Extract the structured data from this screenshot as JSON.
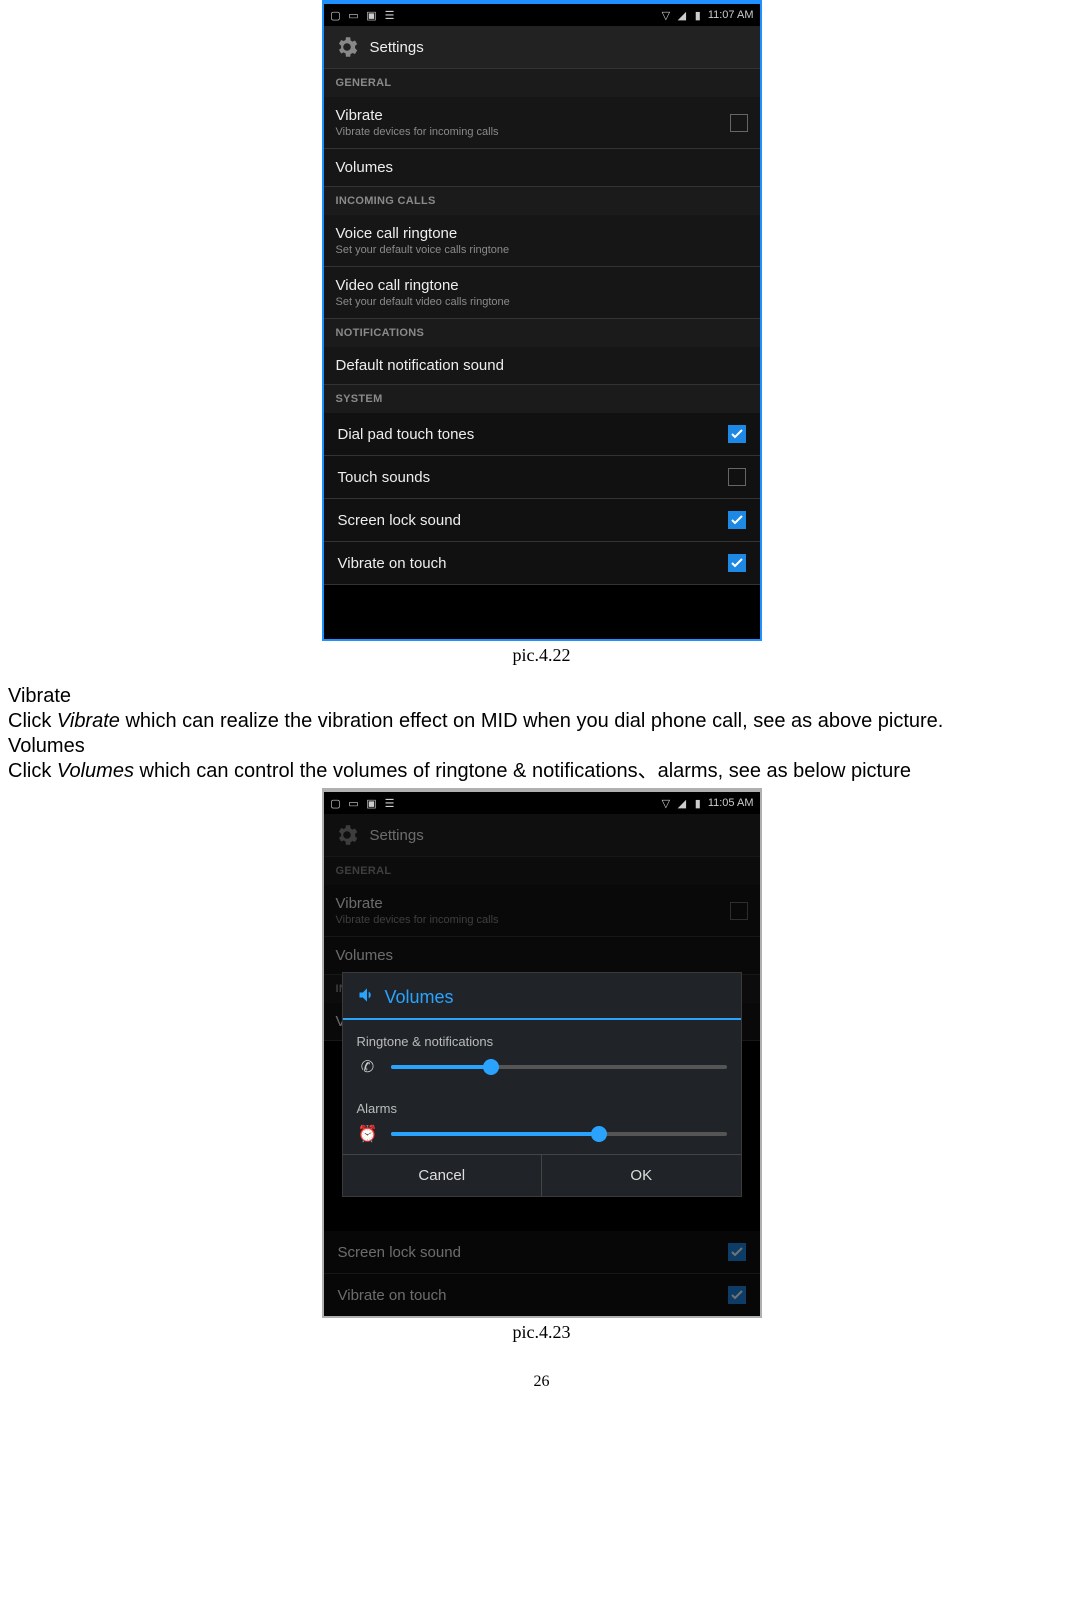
{
  "shot1": {
    "status": {
      "time": "11:07 AM"
    },
    "title": "Settings",
    "sections": {
      "general": "GENERAL",
      "incoming": "INCOMING CALLS",
      "notifications": "NOTIFICATIONS",
      "system": "SYSTEM"
    },
    "rows": {
      "vibrate": {
        "title": "Vibrate",
        "sub": "Vibrate devices for incoming calls"
      },
      "volumes": {
        "title": "Volumes"
      },
      "voice": {
        "title": "Voice call ringtone",
        "sub": "Set your default voice calls ringtone"
      },
      "video": {
        "title": "Video call ringtone",
        "sub": "Set your default video calls ringtone"
      },
      "defnotif": {
        "title": "Default notification sound"
      },
      "dialpad": {
        "title": "Dial pad touch tones"
      },
      "touch": {
        "title": "Touch sounds"
      },
      "lock": {
        "title": "Screen lock sound"
      },
      "vot": {
        "title": "Vibrate on touch"
      }
    }
  },
  "caption1": "pic.4.22",
  "body": {
    "h1": "Vibrate",
    "p1a": "Click ",
    "p1i": "Vibrate",
    "p1b": " which can realize the vibration effect on MID when you dial phone call, see as above picture.",
    "h2": "Volumes",
    "p2a": "Click ",
    "p2i": "Volumes",
    "p2b": " which can control the volumes of ringtone & notifications、alarms, see as below picture"
  },
  "shot2": {
    "status": {
      "time": "11:05 AM"
    },
    "title": "Settings",
    "sections": {
      "general": "GENERAL",
      "incoming": "INCOMING CALLS"
    },
    "rows": {
      "vibrate": {
        "title": "Vibrate",
        "sub": "Vibrate devices for incoming calls"
      },
      "volumes": {
        "title": "Volumes"
      },
      "voice": {
        "title": "Voice call ringtone"
      },
      "lock": {
        "title": "Screen lock sound"
      },
      "vot": {
        "title": "Vibrate on touch"
      }
    },
    "dialog": {
      "title": "Volumes",
      "ring": "Ringtone & notifications",
      "alarms": "Alarms",
      "cancel": "Cancel",
      "ok": "OK",
      "ring_pct": 30,
      "alarm_pct": 62
    }
  },
  "caption2": "pic.4.23",
  "page_num": "26"
}
